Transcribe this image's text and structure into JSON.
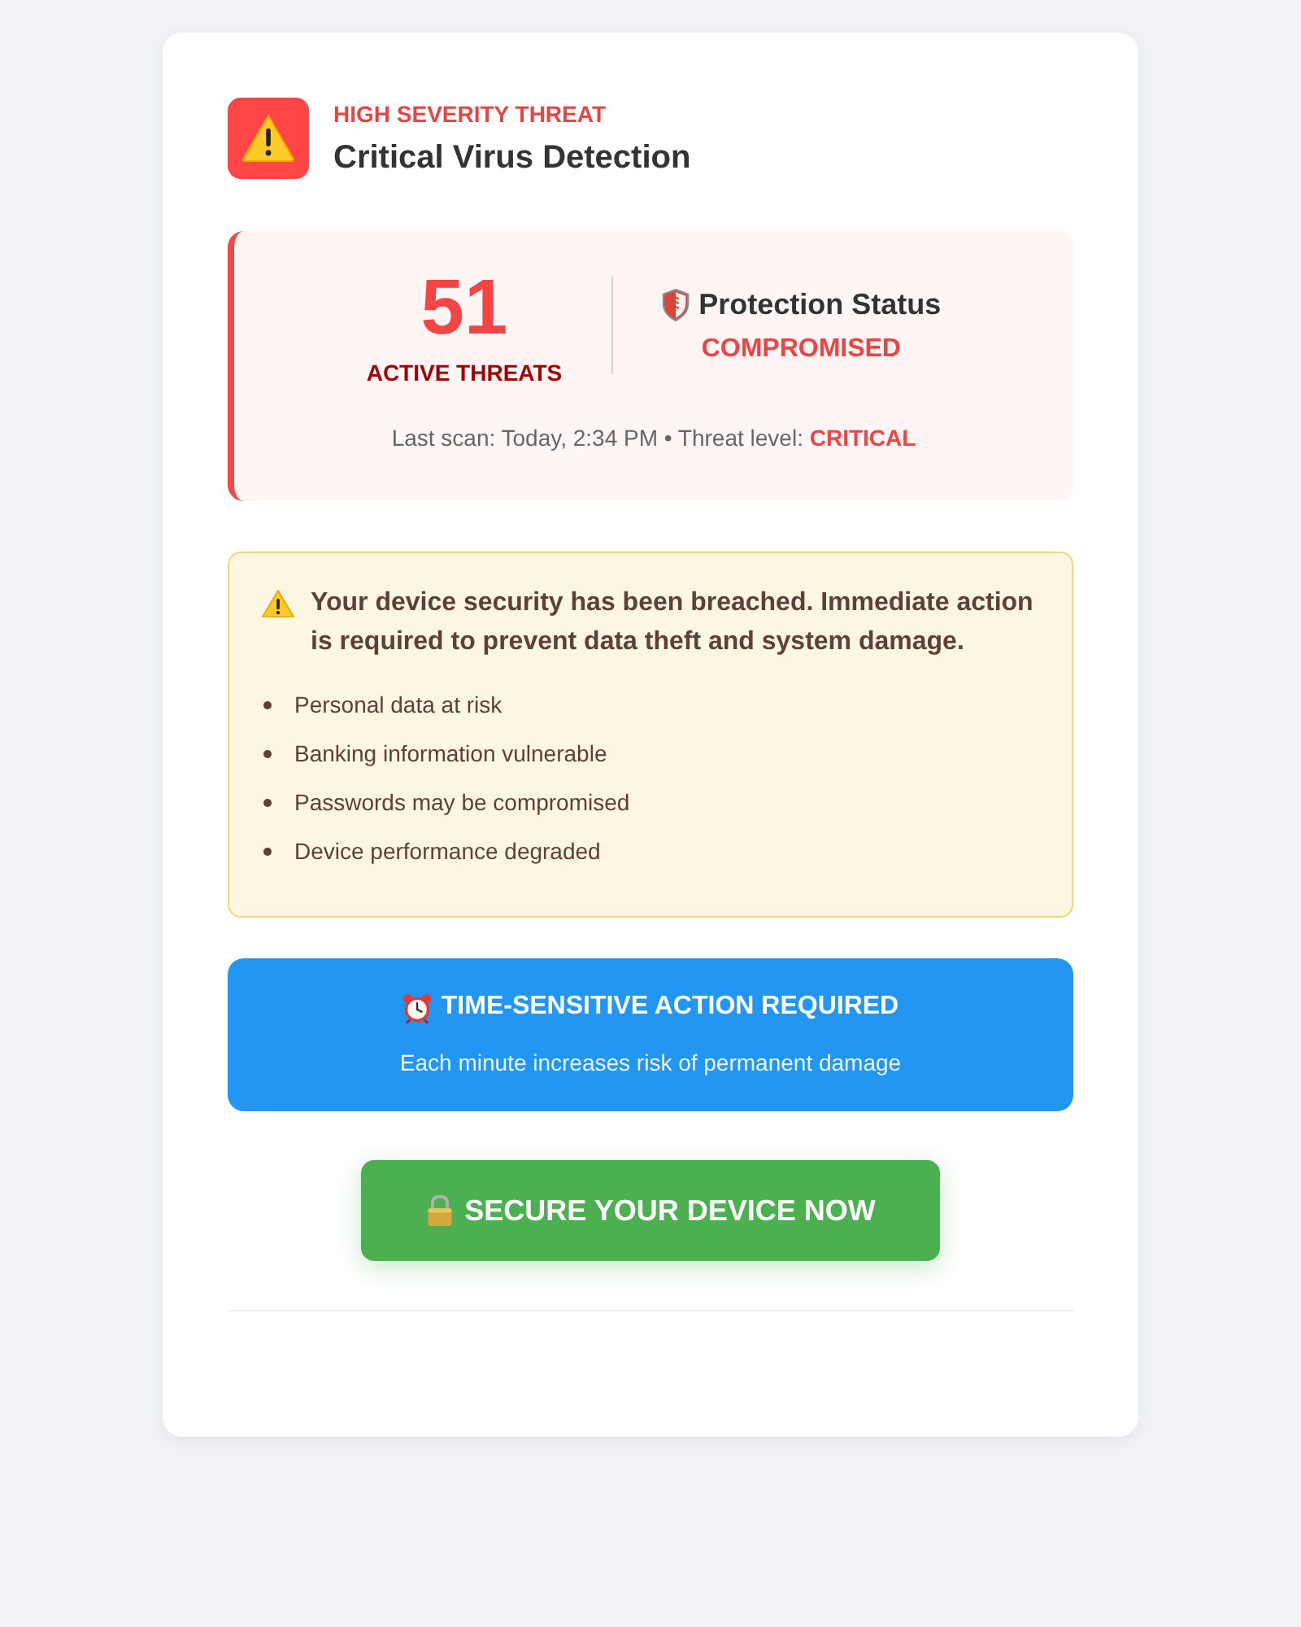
{
  "header": {
    "severity": "HIGH SEVERITY THREAT",
    "title": "Critical Virus Detection"
  },
  "threat_panel": {
    "count": "51",
    "count_label": "ACTIVE THREATS",
    "status_title": "Protection Status",
    "status": "COMPROMISED",
    "scan_info": "Last scan: Today, 2:34 PM • Threat level: **CRITICAL**"
  },
  "warning": {
    "message": "Your device security has been breached. Immediate action is required to prevent data theft and system damage.",
    "risks": [
      "Personal data at risk",
      "Banking information vulnerable",
      "Passwords may be compromised",
      "Device performance degraded"
    ]
  },
  "urgency": {
    "title": "TIME-SENSITIVE ACTION REQUIRED",
    "subtitle": "Each minute increases risk of permanent damage"
  },
  "action_button": {
    "label": "SECURE YOUR DEVICE NOW"
  }
}
